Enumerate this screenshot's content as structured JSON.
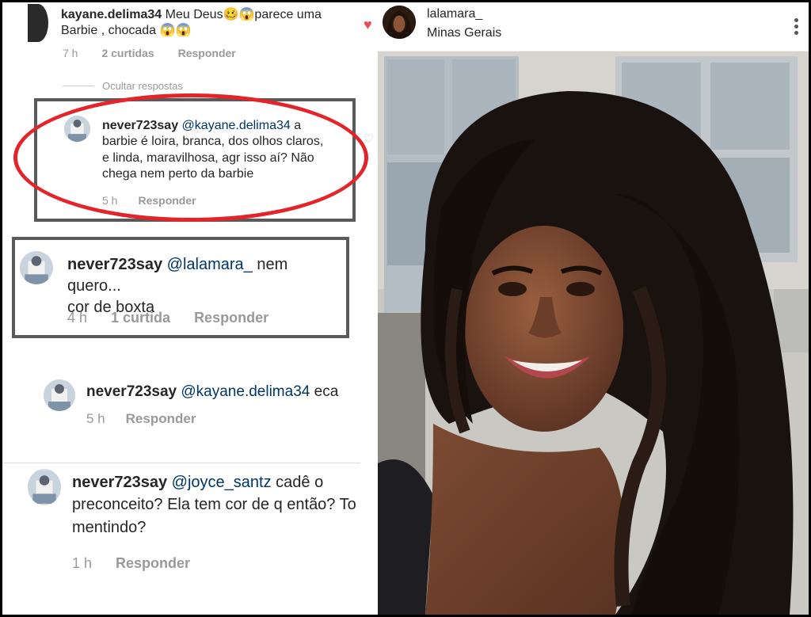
{
  "comments": {
    "top": {
      "username": "kayane.delima34",
      "text_line1": "Meu Deus🥴😱parece uma",
      "text_line2": "Barbie , chocada 😱😱",
      "time": "7 h",
      "likes": "2 curtidas",
      "reply": "Responder"
    },
    "hide_replies": "Ocultar respostas",
    "reply1": {
      "username": "never723say",
      "mention": "@kayane.delima34",
      "text_after_mention": "a",
      "line2": "barbie é loira, branca, dos olhos claros,",
      "line3": "e linda, maravilhosa, agr isso aí? Não",
      "line4": "chega nem perto da barbie",
      "time": "5 h",
      "reply": "Responder"
    },
    "reply2": {
      "username": "never723say",
      "mention": "@lalamara_",
      "text_after_mention": "nem quero...",
      "line2": "cor de boxta",
      "time": "4 h",
      "likes": "1 curtida",
      "reply": "Responder"
    },
    "reply3": {
      "username": "never723say",
      "mention": "@kayane.delima34",
      "text_after_mention": "eca",
      "time": "5 h",
      "reply": "Responder"
    },
    "reply4": {
      "username": "never723say",
      "mention": "@joyce_santz",
      "text_after_mention": "cadê o",
      "line2": "preconceito? Ela tem cor de q então? To",
      "line3": "mentindo?",
      "time": "1 h",
      "reply": "Responder"
    }
  },
  "post": {
    "username": "lalamara_",
    "location": "Minas Gerais",
    "more_icon": "more-vertical-icon",
    "liked_icon": "heart-filled-icon"
  },
  "colors": {
    "highlight_ellipse": "#e3252b",
    "box_border": "#5a5a5a",
    "mention": "#003569",
    "meta": "#999999"
  }
}
